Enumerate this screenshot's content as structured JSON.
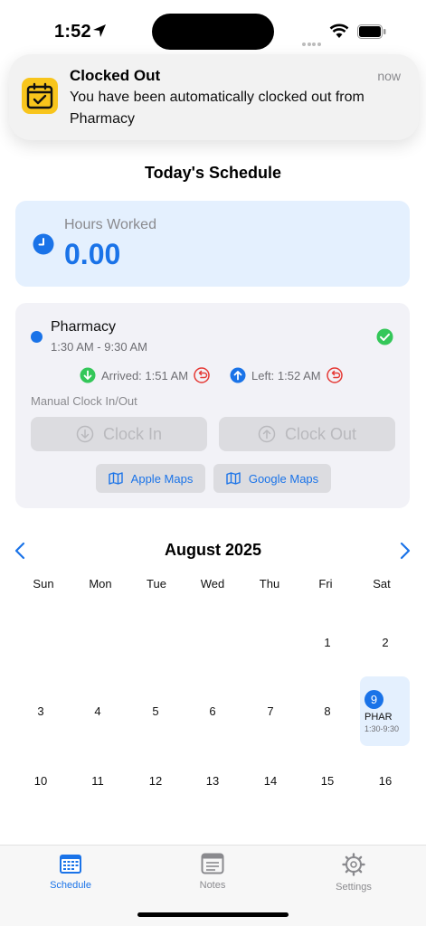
{
  "status_bar": {
    "time": "1:52",
    "location_icon": "location-arrow-icon",
    "wifi_icon": "wifi-icon",
    "battery_icon": "battery-icon"
  },
  "notification": {
    "icon": "calendar-check-icon",
    "title": "Clocked Out",
    "time": "now",
    "body": "You have been automatically clocked out from Pharmacy"
  },
  "schedule": {
    "title": "Today's Schedule",
    "hours": {
      "label": "Hours Worked",
      "value": "0.00",
      "icon": "clock-icon"
    },
    "shift": {
      "name": "Pharmacy",
      "hours": "1:30 AM - 9:30 AM",
      "arrived": "Arrived: 1:51 AM",
      "left": "Left: 1:52 AM",
      "manual_label": "Manual Clock In/Out",
      "clock_in": "Clock In",
      "clock_out": "Clock Out",
      "apple_maps": "Apple Maps",
      "google_maps": "Google Maps"
    }
  },
  "calendar": {
    "month": "August 2025",
    "weekdays": [
      "Sun",
      "Mon",
      "Tue",
      "Wed",
      "Thu",
      "Fri",
      "Sat"
    ],
    "days": [
      "1",
      "2",
      "3",
      "4",
      "5",
      "6",
      "7",
      "8",
      "10",
      "11",
      "12",
      "13",
      "14",
      "15",
      "16"
    ],
    "today": {
      "day": "9",
      "event": "PHAR",
      "time": "1:30-9:30"
    }
  },
  "tabs": [
    {
      "label": "Schedule",
      "icon": "calendar-icon",
      "active": true
    },
    {
      "label": "Notes",
      "icon": "notes-icon",
      "active": false
    },
    {
      "label": "Settings",
      "icon": "gear-icon",
      "active": false
    }
  ],
  "colors": {
    "accent": "#1a73e8",
    "success": "#34c759",
    "danger": "#e53935",
    "notif_icon_bg": "#f8c51c",
    "card_blue": "#e4f0fe"
  }
}
